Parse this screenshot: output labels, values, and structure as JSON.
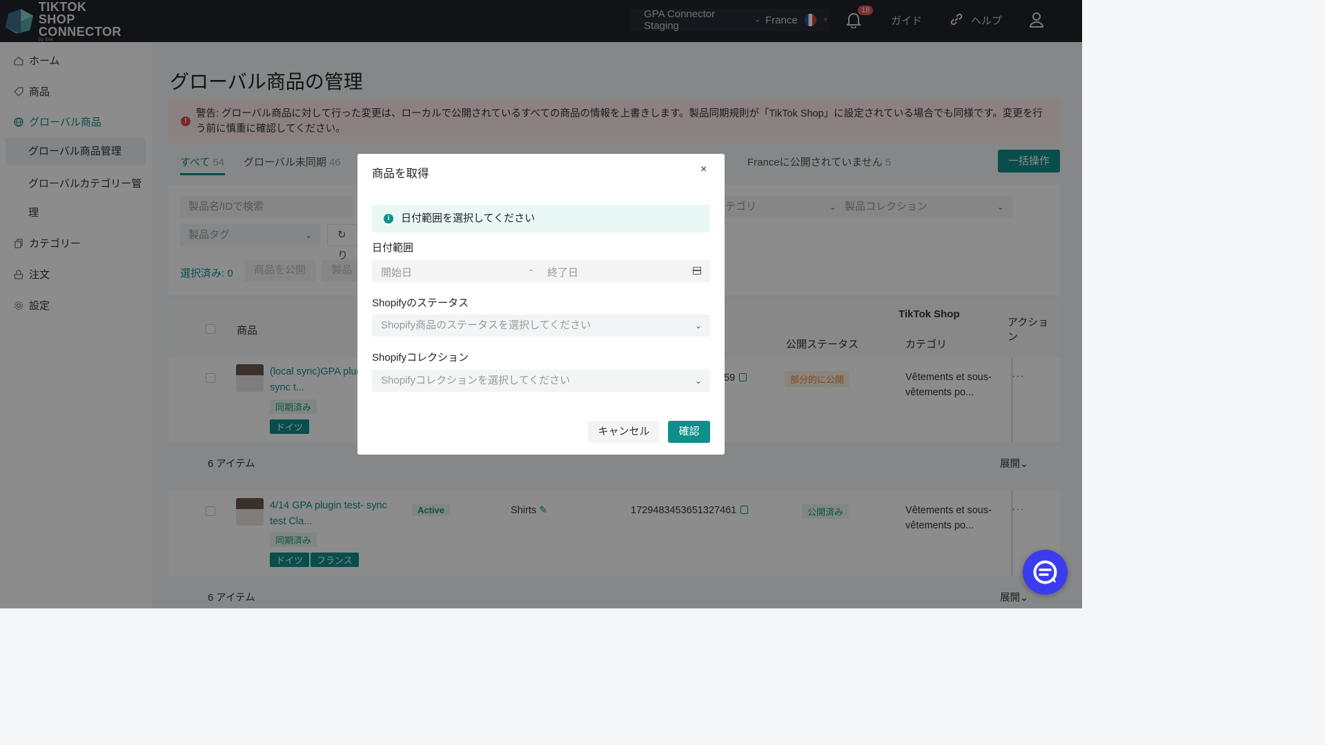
{
  "header": {
    "logo_line1": "TIKTOK SHOP",
    "logo_line2": "CONNECTOR",
    "logo_by": "by Silk",
    "store_name": "GPA Connector Staging",
    "store_sep": "-",
    "store_region": "France",
    "notification_count": "18",
    "guide_label": "ガイド",
    "help_label": "ヘルプ"
  },
  "sidebar": {
    "items": [
      {
        "label": "ホーム",
        "icon": "home-icon"
      },
      {
        "label": "商品",
        "icon": "tag-icon"
      },
      {
        "label": "グローバル商品",
        "icon": "globe-icon"
      },
      {
        "label": "グローバル商品管理"
      },
      {
        "label": "グローバルカテゴリー管"
      },
      {
        "label": "理"
      },
      {
        "label": "カテゴリー",
        "icon": "copy-icon"
      },
      {
        "label": "注文",
        "icon": "cart-icon"
      },
      {
        "label": "設定",
        "icon": "gear-icon"
      }
    ]
  },
  "main": {
    "title": "グローバル商品の管理",
    "alert_text": "警告: グローバル商品に対して行った変更は、ローカルで公開されているすべての商品の情報を上書きします。製品同期規則が「TikTok Shop」に設定されている場合でも同様です。変更を行う前に慎重に確認してください。",
    "tabs": [
      {
        "label": "すべて",
        "count": "54"
      },
      {
        "label": "グローバル未同期",
        "count": "46"
      }
    ],
    "tab_right": {
      "label": "Franceに公開されていません",
      "count": "5"
    },
    "bulk_button": "一括操作",
    "search_placeholder": "製品名/IDで検索",
    "category_placeholder": "カテゴリ",
    "collection_placeholder": "製品コレクション",
    "tag_placeholder": "製品タグ",
    "refresh_label": "り",
    "selected_label": "選択済み: 0",
    "publish_button": "商品を公開",
    "product_button": "製品",
    "columns": {
      "product": "商品",
      "tiktok_shop": "TikTok Shop",
      "actions": "アクション",
      "publish_status": "公開ステータス",
      "category": "カテゴリ"
    },
    "rows": [
      {
        "name": "(local sync)GPA plug",
        "name2": "sync t...",
        "sync_tag": "同期済み",
        "region_tags": [
          "ドイツ"
        ],
        "id_tail": "59",
        "publish_status": "部分的に公開",
        "category1": "Vêtements et sous-",
        "category2": "vêtements po..."
      },
      {
        "name": "4/14 GPA plugin test- sync",
        "name2": "test Cla...",
        "sync_tag": "同期済み",
        "region_tags": [
          "ドイツ",
          "フランス"
        ],
        "status": "Active",
        "product_type": "Shirts",
        "product_id": "1729483453651327461",
        "publish_status": "公開済み",
        "category1": "Vêtements et sous-",
        "category2": "vêtements po..."
      }
    ],
    "group_label": "6 アイテム",
    "expand_label": "展開",
    "row_actions": "···"
  },
  "modal": {
    "title": "商品を取得",
    "close": "×",
    "info_text": "日付範囲を選択してください",
    "date_label": "日付範囲",
    "start_placeholder": "開始日",
    "date_sep": "-",
    "end_placeholder": "終了日",
    "status_label": "Shopifyのステータス",
    "status_placeholder": "Shopify商品のステータスを選択してください",
    "collection_label": "Shopifyコレクション",
    "collection_placeholder": "Shopifyコレクションを選択してください",
    "cancel": "キャンセル",
    "confirm": "確認"
  },
  "colors": {
    "accent": "#0e8f8a",
    "topbar": "#1f232a",
    "alert_bg": "#fdecec",
    "chat": "#3b3bf0"
  }
}
